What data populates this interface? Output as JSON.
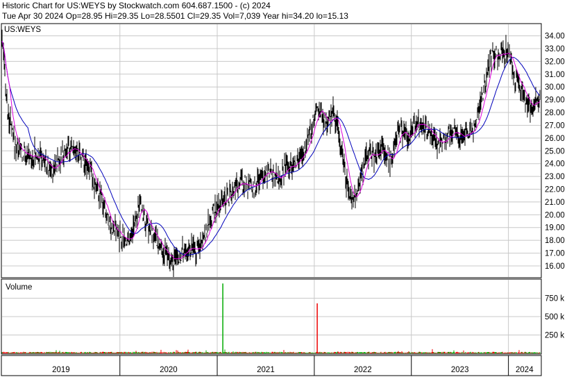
{
  "header": {
    "line1": "Historic Chart for US:WEYS by Stockwatch.com 604.687.1500 - (c) 2024",
    "line2": "Tue Apr 30 2024   Op=28.95   Hi=29.35   Lo=28.5501   Cl=29.35   Vol=7,039   Year hi=34.20   lo=15.13"
  },
  "chart_data": {
    "type": "line",
    "symbol_label": "US:WEYS",
    "volume_label": "Volume",
    "price_axis": {
      "ylim": [
        15.13,
        34.9
      ],
      "ticks": [
        "16.00",
        "17.00",
        "18.00",
        "19.00",
        "20.00",
        "21.00",
        "22.00",
        "23.00",
        "24.00",
        "25.00",
        "26.00",
        "27.00",
        "28.00",
        "29.00",
        "30.00",
        "31.00",
        "32.00",
        "33.00",
        "34.00"
      ]
    },
    "volume_axis": {
      "ylim": [
        0,
        1000000
      ],
      "ticks": [
        {
          "value": 750000,
          "label": "750 k"
        },
        {
          "value": 500000,
          "label": "500 k"
        },
        {
          "value": 250000,
          "label": "250 k"
        }
      ]
    },
    "x_axis": {
      "start": "2018-10-15",
      "end": "2024-05-01",
      "year_labels": [
        "2019",
        "2020",
        "2021",
        "2022",
        "2023",
        "2024"
      ],
      "grid": true
    },
    "grid": true,
    "price_keypoints": [
      [
        "2018-10-15",
        33.6
      ],
      [
        "2018-11-05",
        28.0
      ],
      [
        "2018-12-01",
        25.5
      ],
      [
        "2019-01-15",
        24.5
      ],
      [
        "2019-03-01",
        24.8
      ],
      [
        "2019-04-15",
        23.5
      ],
      [
        "2019-06-01",
        24.8
      ],
      [
        "2019-07-15",
        25.2
      ],
      [
        "2019-09-01",
        24.0
      ],
      [
        "2019-10-15",
        21.5
      ],
      [
        "2019-12-01",
        19.0
      ],
      [
        "2020-01-15",
        18.0
      ],
      [
        "2020-02-15",
        18.5
      ],
      [
        "2020-03-15",
        21.0
      ],
      [
        "2020-04-15",
        19.0
      ],
      [
        "2020-05-15",
        18.0
      ],
      [
        "2020-06-15",
        17.0
      ],
      [
        "2020-07-15",
        16.2
      ],
      [
        "2020-08-15",
        16.8
      ],
      [
        "2020-09-15",
        17.5
      ],
      [
        "2020-10-15",
        17.0
      ],
      [
        "2020-11-15",
        18.5
      ],
      [
        "2020-12-15",
        20.0
      ],
      [
        "2021-01-15",
        21.0
      ],
      [
        "2021-02-15",
        21.5
      ],
      [
        "2021-04-01",
        22.5
      ],
      [
        "2021-05-15",
        22.0
      ],
      [
        "2021-07-01",
        23.5
      ],
      [
        "2021-08-15",
        23.0
      ],
      [
        "2021-10-01",
        24.0
      ],
      [
        "2021-11-15",
        24.5
      ],
      [
        "2021-12-15",
        26.5
      ],
      [
        "2022-01-15",
        28.5
      ],
      [
        "2022-02-15",
        27.0
      ],
      [
        "2022-03-15",
        28.0
      ],
      [
        "2022-04-15",
        25.0
      ],
      [
        "2022-05-15",
        21.0
      ],
      [
        "2022-06-15",
        22.0
      ],
      [
        "2022-07-15",
        25.0
      ],
      [
        "2022-08-15",
        24.5
      ],
      [
        "2022-09-15",
        25.5
      ],
      [
        "2022-10-15",
        24.0
      ],
      [
        "2022-11-15",
        26.5
      ],
      [
        "2022-12-15",
        26.0
      ],
      [
        "2023-01-15",
        27.0
      ],
      [
        "2023-03-01",
        26.5
      ],
      [
        "2023-04-15",
        25.5
      ],
      [
        "2023-06-01",
        26.5
      ],
      [
        "2023-07-15",
        26.0
      ],
      [
        "2023-09-01",
        27.0
      ],
      [
        "2023-10-01",
        30.0
      ],
      [
        "2023-11-01",
        32.5
      ],
      [
        "2023-12-01",
        32.5
      ],
      [
        "2024-01-01",
        32.8
      ],
      [
        "2024-01-20",
        31.0
      ],
      [
        "2024-02-15",
        30.0
      ],
      [
        "2024-03-15",
        28.5
      ],
      [
        "2024-04-30",
        29.35
      ]
    ],
    "volume_spikes": [
      {
        "date": "2021-01-22",
        "value": 950000,
        "color": "#00aa00"
      },
      {
        "date": "2022-01-12",
        "value": 680000,
        "color": "#ee0000"
      }
    ],
    "series_colors": {
      "price": "#000000",
      "short_ma": "#dd00dd",
      "long_ma": "#0000bb",
      "volume_up": "#00aa00",
      "volume_down": "#ee0000"
    }
  }
}
